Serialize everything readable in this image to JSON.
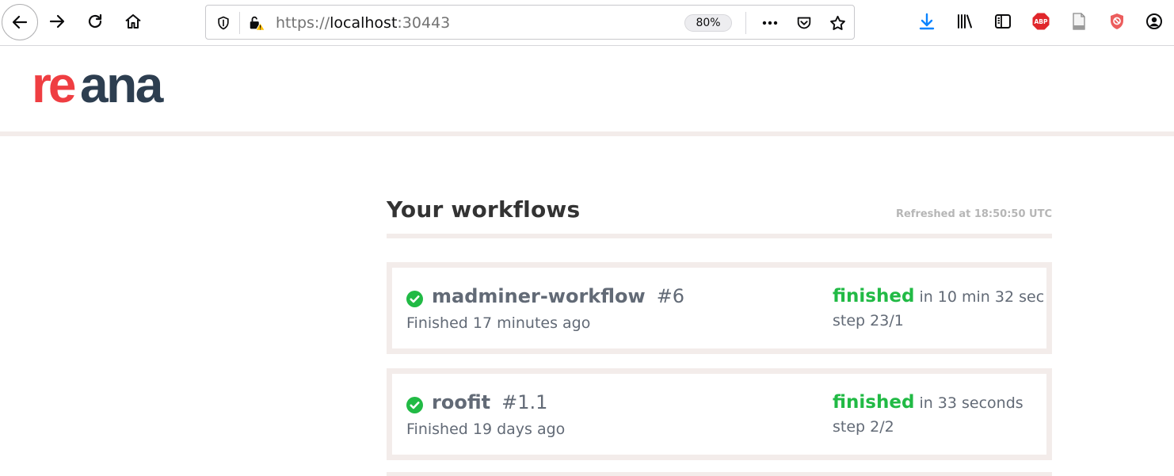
{
  "browser": {
    "url": {
      "scheme": "https://",
      "host": "localhost",
      "port": ":30443"
    },
    "zoom": "80%"
  },
  "header": {
    "logo_text_accent": "re",
    "logo_text_rest": "ana",
    "accent_color": "#ef3e42",
    "text_color": "#2d3e50"
  },
  "main": {
    "title": "Your workflows",
    "refreshed": "Refreshed at 18:50:50 UTC"
  },
  "workflows": [
    {
      "name": "madminer-workflow",
      "run": "#6",
      "finished_ago": "Finished 17 minutes ago",
      "status": "finished",
      "duration": "in 10 min 32 sec",
      "step": "step 23/1"
    },
    {
      "name": "roofit",
      "run": "#1.1",
      "finished_ago": "Finished 19 days ago",
      "status": "finished",
      "duration": "in 33 seconds",
      "step": "step 2/2"
    }
  ],
  "colors": {
    "finished": "#21ba45",
    "card_border": "#f3ecea",
    "muted_text": "#626a76"
  }
}
